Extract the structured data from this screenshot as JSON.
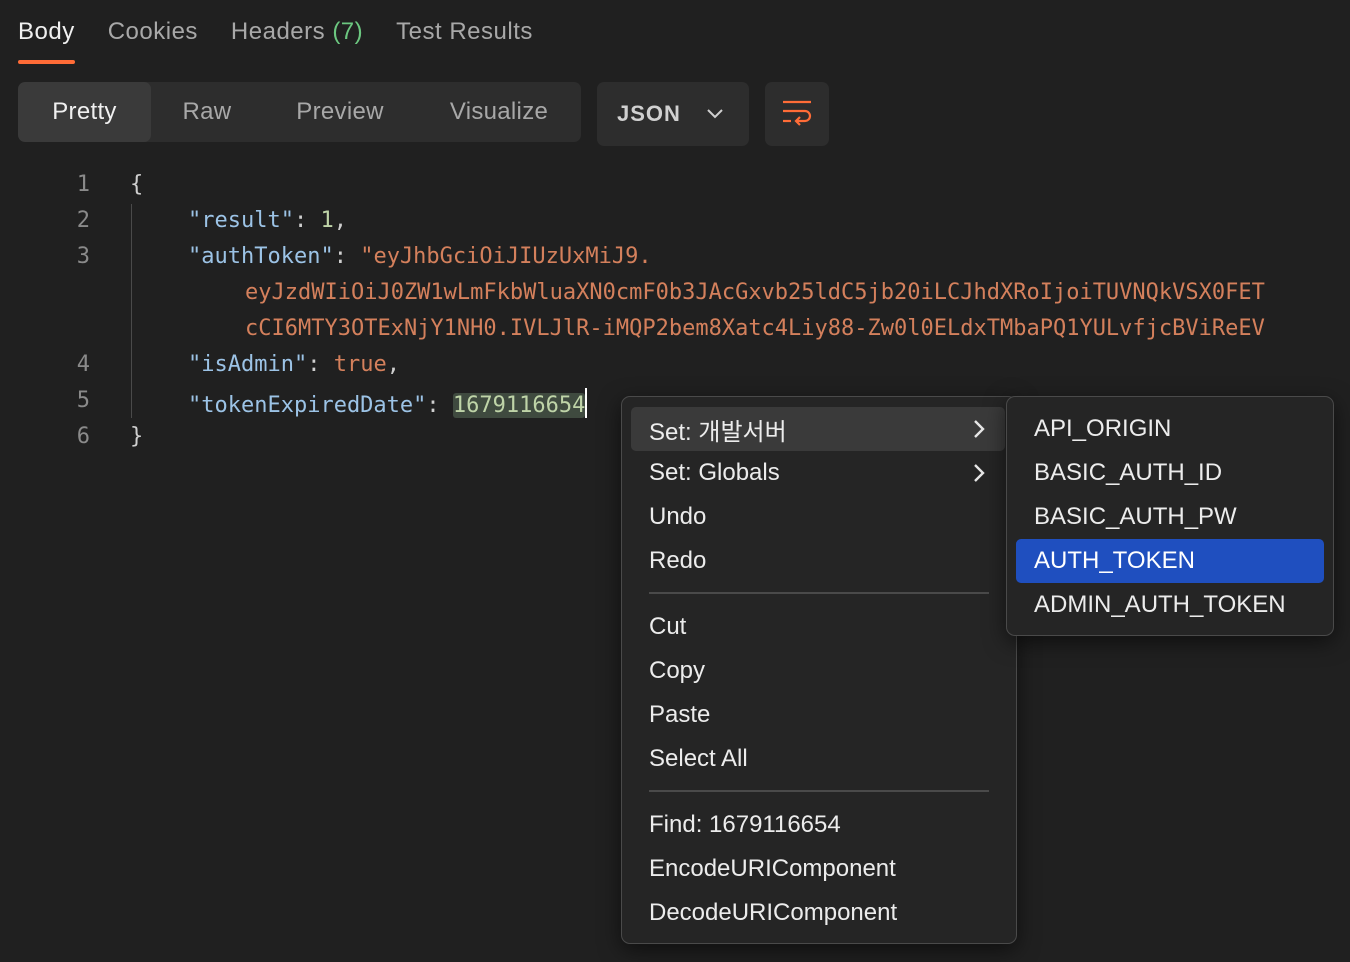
{
  "tabs": [
    {
      "label": "Body",
      "active": true
    },
    {
      "label": "Cookies"
    },
    {
      "label": "Headers",
      "count": "(7)"
    },
    {
      "label": "Test Results"
    }
  ],
  "view_modes": [
    "Pretty",
    "Raw",
    "Preview",
    "Visualize"
  ],
  "active_view": "Pretty",
  "format": {
    "label": "JSON",
    "icon": "chevron-down-icon"
  },
  "wrap_icon": "wrap-lines-icon",
  "code": {
    "line_numbers": [
      "1",
      "2",
      "3",
      "4",
      "5",
      "6"
    ],
    "open_brace": "{",
    "close_brace": "}",
    "lines": {
      "result_key": "\"result\"",
      "result_value": "1",
      "authToken_key": "\"authToken\"",
      "authToken_value_1": "\"eyJhbGciOiJIUzUxMiJ9.",
      "authToken_value_2": "eyJzdWIiOiJ0ZW1wLmFkbWluaXN0cmF0b3JAcGxvb25ldC5jb20iLCJhdXRoIjoiTUVNQkVSX0FET",
      "authToken_value_3": "cCI6MTY3OTExNjY1NH0.IVLJlR-iMQP2bem8Xatc4Liy88-Zw0l0ELdxTMbaPQ1YULvfjcBViReEV",
      "isAdmin_key": "\"isAdmin\"",
      "isAdmin_value": "true",
      "tokenExpiredDate_key": "\"tokenExpiredDate\"",
      "tokenExpiredDate_value": "1679116654"
    }
  },
  "context_menu": {
    "items": [
      {
        "label": "Set: 개발서버",
        "submenu": true
      },
      {
        "label": "Set: Globals",
        "submenu": true
      },
      {
        "label": "Undo"
      },
      {
        "label": "Redo"
      },
      {
        "label": "Cut"
      },
      {
        "label": "Copy"
      },
      {
        "label": "Paste"
      },
      {
        "label": "Select All"
      },
      {
        "label": "Find: 1679116654"
      },
      {
        "label": "EncodeURIComponent"
      },
      {
        "label": "DecodeURIComponent"
      }
    ]
  },
  "submenu": {
    "items": [
      "API_ORIGIN",
      "BASIC_AUTH_ID",
      "BASIC_AUTH_PW",
      "AUTH_TOKEN",
      "ADMIN_AUTH_TOKEN"
    ],
    "highlighted": "AUTH_TOKEN"
  },
  "colors": {
    "accent": "#ff6c37",
    "highlight": "#1f4fbf",
    "count": "#6cc780"
  }
}
